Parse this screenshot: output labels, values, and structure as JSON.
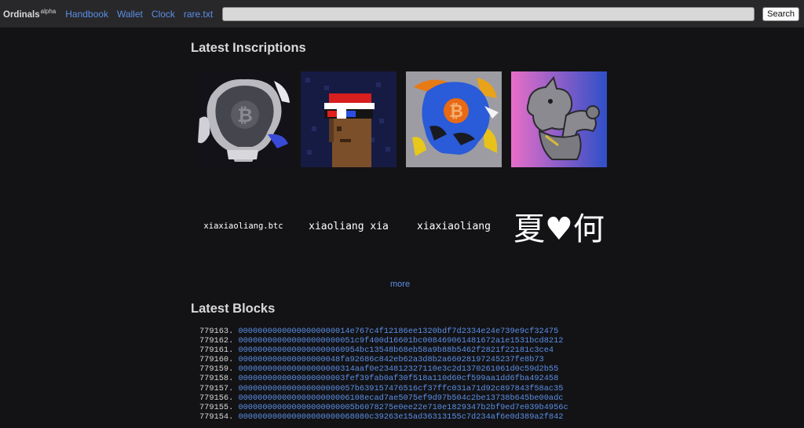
{
  "nav": {
    "brand": "Ordinals",
    "brand_sup": "alpha",
    "links": [
      "Handbook",
      "Wallet",
      "Clock",
      "rare.txt"
    ],
    "search_value": "",
    "search_button": "Search"
  },
  "inscriptions": {
    "heading": "Latest Inscriptions",
    "images": [
      {
        "name": "skull-bitcoin-grey",
        "colors": [
          "#1a1a22",
          "#9a9aa0"
        ]
      },
      {
        "name": "pixel-punk-red-cap",
        "colors": [
          "#1a1f4a",
          "#e02424"
        ]
      },
      {
        "name": "skull-bitcoin-blue-orange",
        "colors": [
          "#9a9aa0",
          "#2a5fd8"
        ]
      },
      {
        "name": "rhino-flexing",
        "colors": [
          "#e070c8",
          "#3050c8"
        ]
      }
    ],
    "text_items": [
      "xiaxiaoliang.btc",
      "xiaoliang xia",
      "xiaxiaoliang",
      "夏♥何"
    ],
    "more": "more"
  },
  "blocks": {
    "heading": "Latest Blocks",
    "items": [
      {
        "height": "779163.",
        "hash": "00000000000000000000014e767c4f12186ee1320bdf7d2334e24e739e9cf32475"
      },
      {
        "height": "779162.",
        "hash": "000000000000000000000051c9f400d16601bc008469061481672a1e1531bcd8212"
      },
      {
        "height": "779161.",
        "hash": "0000000000000000000060954bc13548b68eb58a9b88b5462f2821f22181c3ce4"
      },
      {
        "height": "779160.",
        "hash": "000000000000000000048fa92686c842eb62a3d8b2a66028197245237fe8b73"
      },
      {
        "height": "779159.",
        "hash": "000000000000000000000314aaf0e234812327110e3c2d1370261061d0c59d2b55"
      },
      {
        "height": "779158.",
        "hash": "0000000000000000000003fef39fab0af30f518a110d60cf599aa1dd6fba492458"
      },
      {
        "height": "779157.",
        "hash": "000000000000000000000057b639157476516cf37ffc031a71d92c897843f58ac35"
      },
      {
        "height": "779156.",
        "hash": "00000000000000000000006108ecad7ae5075ef9d97b504c2be13738b645be00adc"
      },
      {
        "height": "779155.",
        "hash": "000000000000000000000005b6078275e0ee22e710e1829347b2bf9ed7e039b4956c"
      },
      {
        "height": "779154.",
        "hash": "000000000000000000000068080c39263e15ad36313155c7d234af6e0d389a2f842"
      }
    ]
  },
  "colors": {
    "link": "#5b8fe6",
    "background": "#131316",
    "topbar": "#28282b"
  }
}
